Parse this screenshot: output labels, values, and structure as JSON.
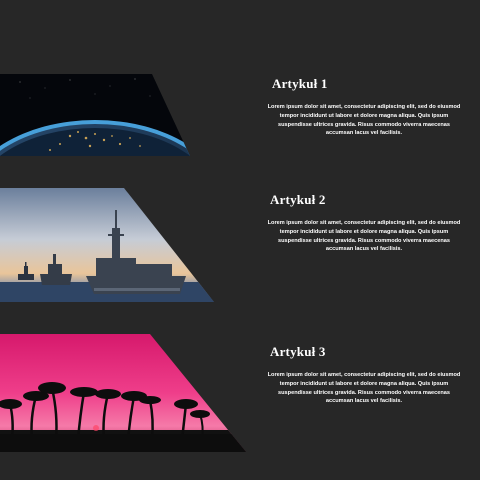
{
  "articles": [
    {
      "title": "Artykuł 1",
      "body": "Lorem ipsum dolor sit amet, consectetur adipiscing elit, sed do eiusmod tempor incididunt ut labore et dolore magna aliqua. Quis ipsum suspendisse ultrices gravida. Risus commodo viverra maecenas accumsan lacus vel facilisis.",
      "image": "earth-from-space-image"
    },
    {
      "title": "Artykuł 2",
      "body": "Lorem ipsum dolor sit amet, consectetur adipiscing elit, sed do eiusmod tempor incididunt ut labore et dolore magna aliqua. Quis ipsum suspendisse ultrices gravida. Risus commodo viverra maecenas accumsan lacus vel facilisis.",
      "image": "warships-at-sea-image"
    },
    {
      "title": "Artykuł 3",
      "body": "Lorem ipsum dolor sit amet, consectetur adipiscing elit, sed do eiusmod tempor incididunt ut labore et dolore magna aliqua. Quis ipsum suspendisse ultrices gravida. Risus commodo viverra maecenas accumsan lacus vel facilisis.",
      "image": "palm-trees-sunset-image"
    }
  ],
  "colors": {
    "background": "#272727",
    "text": "#ffffff",
    "sunset_pink": "#e0207a",
    "space_blue": "#1c5aa0"
  }
}
